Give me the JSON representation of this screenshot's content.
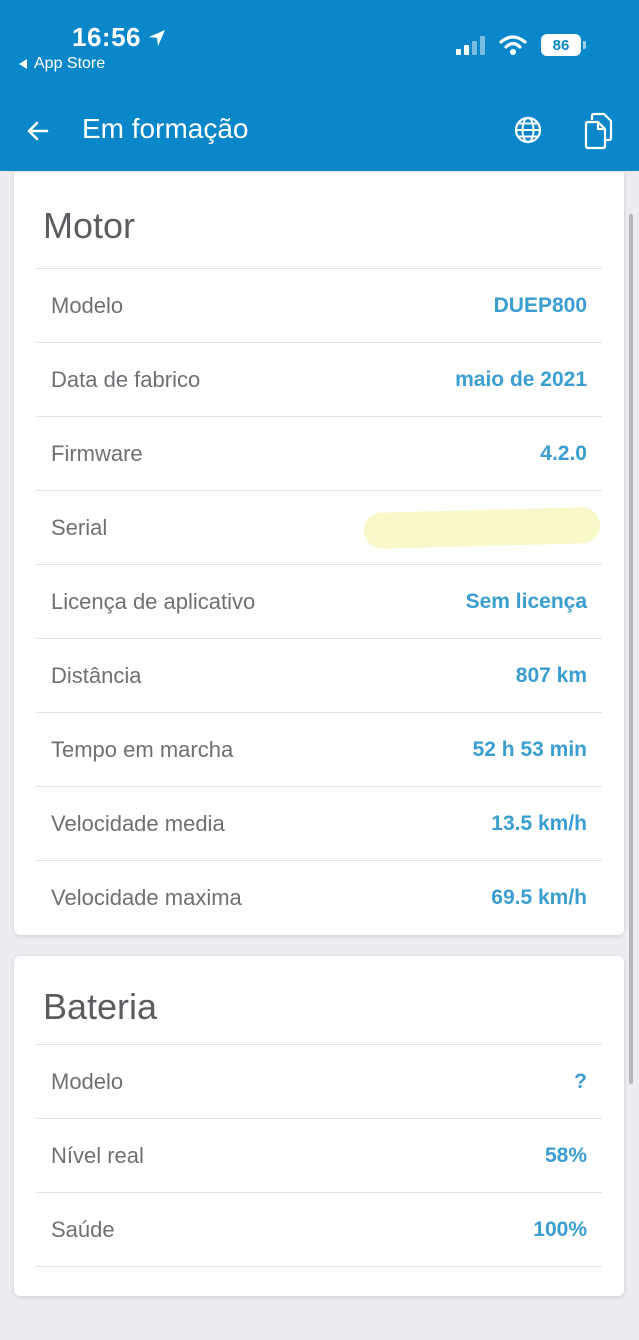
{
  "status_bar": {
    "time": "16:56",
    "back_app": "App Store",
    "battery_level": "86"
  },
  "header": {
    "title": "Em formação",
    "background_color": "#0a87c8"
  },
  "motor": {
    "title": "Motor",
    "rows": [
      {
        "label": "Modelo",
        "value": "DUEP800"
      },
      {
        "label": "Data de fabrico",
        "value": "maio de 2021"
      },
      {
        "label": "Firmware",
        "value": "4.2.0"
      },
      {
        "label": "Serial",
        "value": "...",
        "redacted": true
      },
      {
        "label": "Licença de aplicativo",
        "value": "Sem licença"
      },
      {
        "label": "Distância",
        "value": "807 km"
      },
      {
        "label": "Tempo em marcha",
        "value": "52 h 53 min"
      },
      {
        "label": "Velocidade media",
        "value": "13.5 km/h"
      },
      {
        "label": "Velocidade maxima",
        "value": "69.5 km/h"
      }
    ]
  },
  "battery": {
    "title": "Bateria",
    "rows": [
      {
        "label": "Modelo",
        "value": "?"
      },
      {
        "label": "Nível real",
        "value": "58%"
      },
      {
        "label": "Saúde",
        "value": "100%"
      }
    ]
  },
  "colors": {
    "accent": "#0a87c8",
    "value_text": "#3a9ed0",
    "label_text": "#6f6f74"
  }
}
